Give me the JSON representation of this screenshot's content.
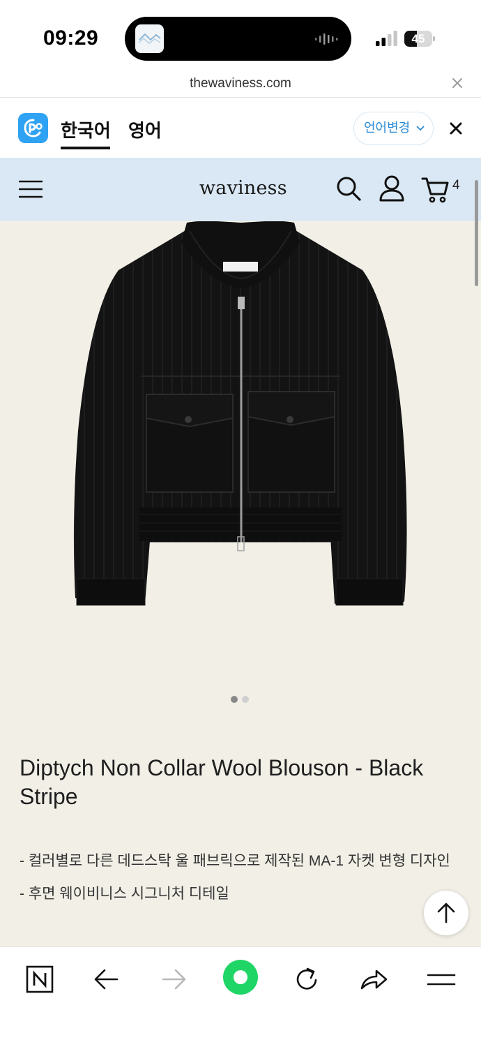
{
  "status_bar": {
    "time": "09:29",
    "battery": "45",
    "battery_level": 0.45,
    "icons": [
      "signal-icon",
      "battery-icon",
      "audio-wave-icon"
    ]
  },
  "browser": {
    "url": "thewaviness.com"
  },
  "translate_bar": {
    "active_lang": "한국어",
    "other_lang": "영어",
    "change_label": "언어변경",
    "accent_color": "#2b8cd6"
  },
  "site_header": {
    "logo": "waviness",
    "cart_count": "4",
    "background": "#d9e8f4"
  },
  "product": {
    "title": "Diptych Non Collar Wool Blouson - Black Stripe",
    "description": [
      "- 컬러별로 다른 데드스탁 울 패브릭으로 제작된 MA-1 자켓 변형 디자인",
      "- 후면 웨이비니스 시그니처 디테일"
    ],
    "image_count": 2,
    "current_image": 1,
    "background": "#f1efe6"
  },
  "bottom_nav": {
    "icons": [
      "naver-icon",
      "back-arrow-icon",
      "forward-arrow-icon",
      "home-circle-icon",
      "refresh-icon",
      "share-icon",
      "menu-icon"
    ],
    "home_color": "#1fd565"
  }
}
